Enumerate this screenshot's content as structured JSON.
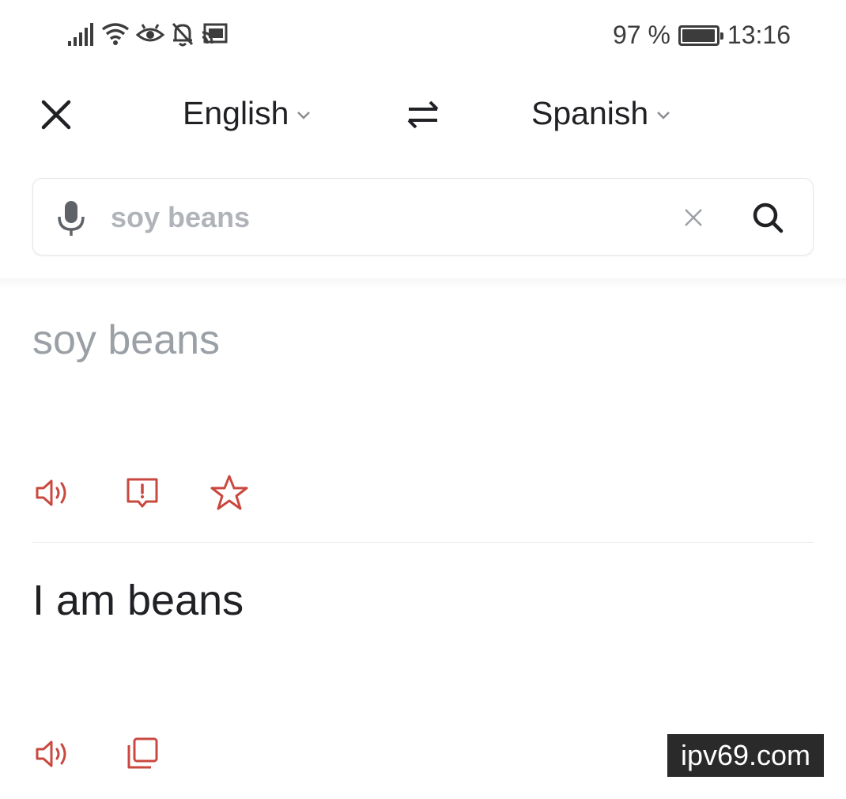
{
  "status_bar": {
    "battery_percent": "97 %",
    "battery_level": 0.97,
    "time": "13:16",
    "icons": [
      "signal-icon",
      "wifi-icon",
      "eye-icon",
      "bell-off-icon",
      "cast-icon"
    ]
  },
  "languages": {
    "source": "English",
    "target": "Spanish"
  },
  "search": {
    "value": "soy beans",
    "placeholder": ""
  },
  "source_text": "soy beans",
  "translation": "I am beans",
  "watermark": "ipv69.com",
  "colors": {
    "accent": "#c9483f",
    "muted_text": "#9aa0a6",
    "primary_text": "#202124"
  }
}
